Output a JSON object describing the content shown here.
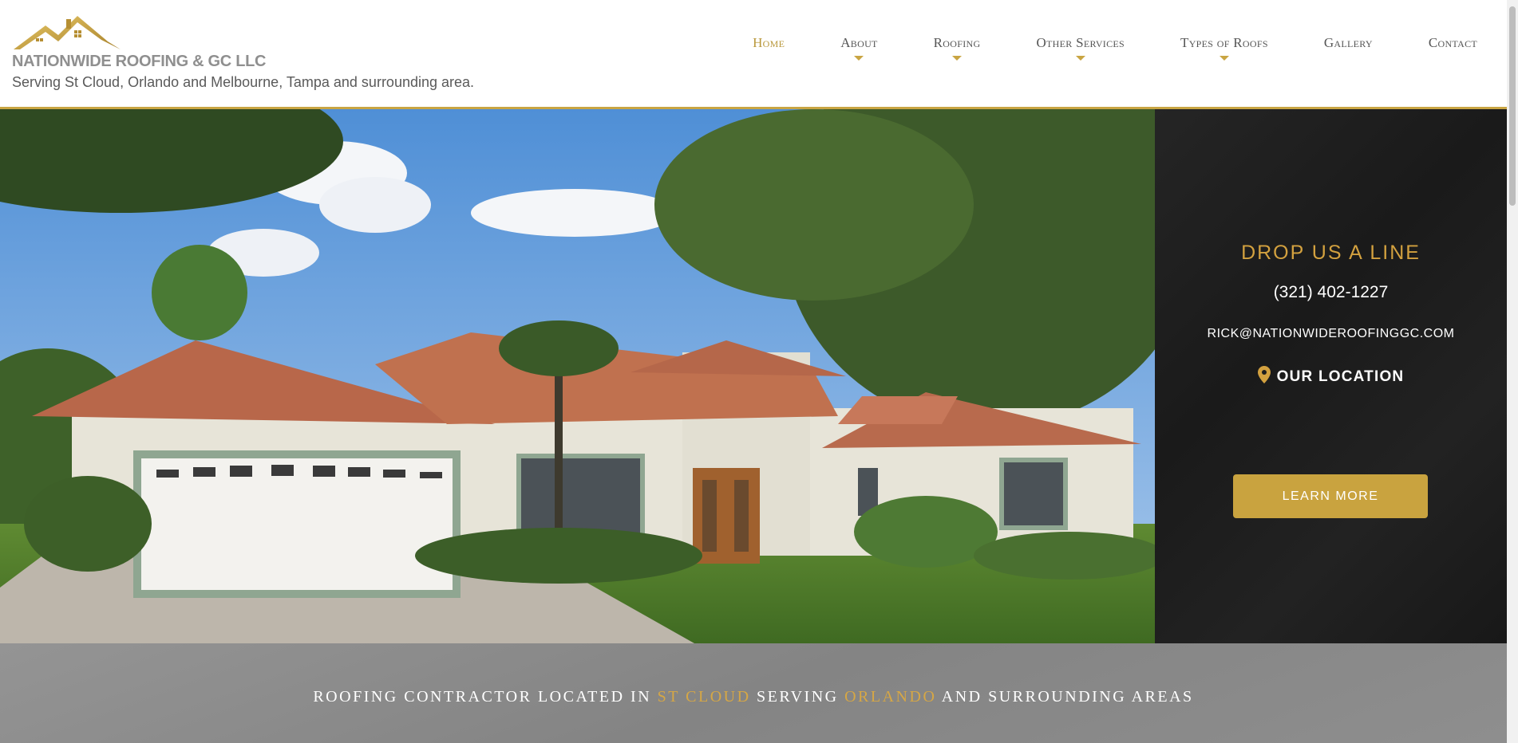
{
  "brand": {
    "name": "NATIONWIDE ROOFING & GC LLC",
    "tagline": "Serving St Cloud, Orlando and Melbourne, Tampa and surrounding area."
  },
  "nav": {
    "home": "Home",
    "about": "About",
    "roofing": "Roofing",
    "other": "Other Services",
    "types": "Types of Roofs",
    "gallery": "Gallery",
    "contact": "Contact"
  },
  "sidebar": {
    "title": "DROP US A LINE",
    "phone": "(321) 402-1227",
    "email": "RICK@NATIONWIDEROOFINGGC.COM",
    "location": "OUR LOCATION",
    "button": "LEARN MORE"
  },
  "banner": {
    "p1": "ROOFING CONTRACTOR LOCATED IN ",
    "p2": "ST CLOUD",
    "p3": " SERVING ",
    "p4": "ORLANDO",
    "p5": " AND SURROUNDING AREAS"
  },
  "colors": {
    "accent": "#c9a543",
    "dark": "#1e1e1e",
    "banner": "#8a8a8a"
  }
}
